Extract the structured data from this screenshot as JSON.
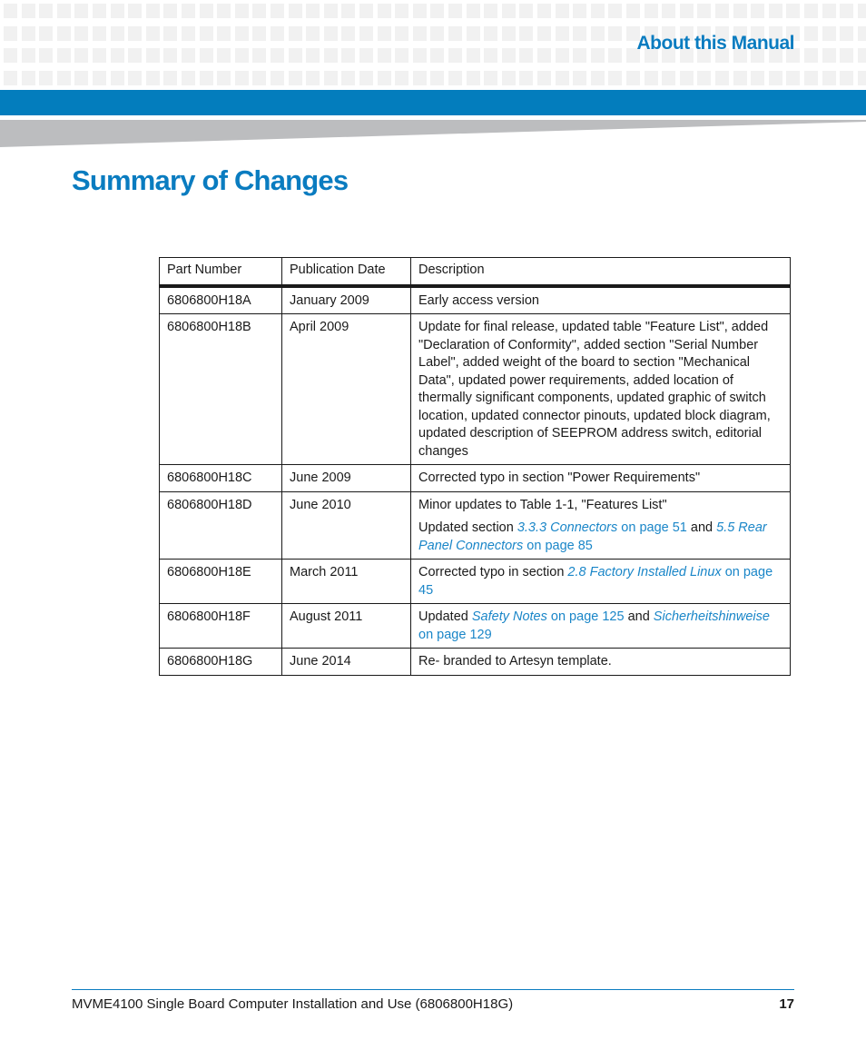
{
  "header": {
    "section_title": "About this Manual",
    "accent_color": "#037dbd"
  },
  "page_title": "Summary of Changes",
  "table": {
    "columns": [
      "Part Number",
      "Publication Date",
      "Description"
    ],
    "rows": [
      {
        "part": "6806800H18A",
        "date": "January 2009",
        "desc": "Early access version"
      },
      {
        "part": "6806800H18B",
        "date": "April 2009",
        "desc": "Update for final release, updated table \"Feature List\", added \"Declaration of Conformity\", added section \"Serial Number Label\", added weight of the board to section \"Mechanical Data\", updated power requirements, added location of thermally significant components, updated graphic of switch location, updated connector pinouts, updated block diagram, updated description of SEEPROM address switch, editorial changes"
      },
      {
        "part": "6806800H18C",
        "date": "June 2009",
        "desc": "Corrected typo in section \"Power Requirements\""
      },
      {
        "part": "6806800H18D",
        "date": "June 2010",
        "desc": "Minor updates to Table 1-1, \"Features List\"",
        "desc2": {
          "prefix": "Updated section ",
          "link1": "3.3.3 Connectors",
          "link1_page": " on page 51",
          "mid": " and ",
          "link2": "5.5 Rear Panel Connectors",
          "link2_page": " on page 85"
        }
      },
      {
        "part": "6806800H18E",
        "date": "March 2011",
        "desc": {
          "prefix": "Corrected typo in section ",
          "link": "2.8 Factory Installed Linux",
          "link_page": " on page 45"
        }
      },
      {
        "part": "6806800H18F",
        "date": "August 2011",
        "desc": {
          "prefix": "Updated ",
          "link1": "Safety Notes",
          "link1_page": " on page 125",
          "mid": " and ",
          "link2": "Sicherheitshinweise",
          "link2_page": " on page 129"
        }
      },
      {
        "part": "6806800H18G",
        "date": "June 2014",
        "desc": "Re- branded to Artesyn template."
      }
    ]
  },
  "footer": {
    "text": "MVME4100 Single Board Computer Installation and Use (6806800H18G)",
    "page_number": "17"
  }
}
